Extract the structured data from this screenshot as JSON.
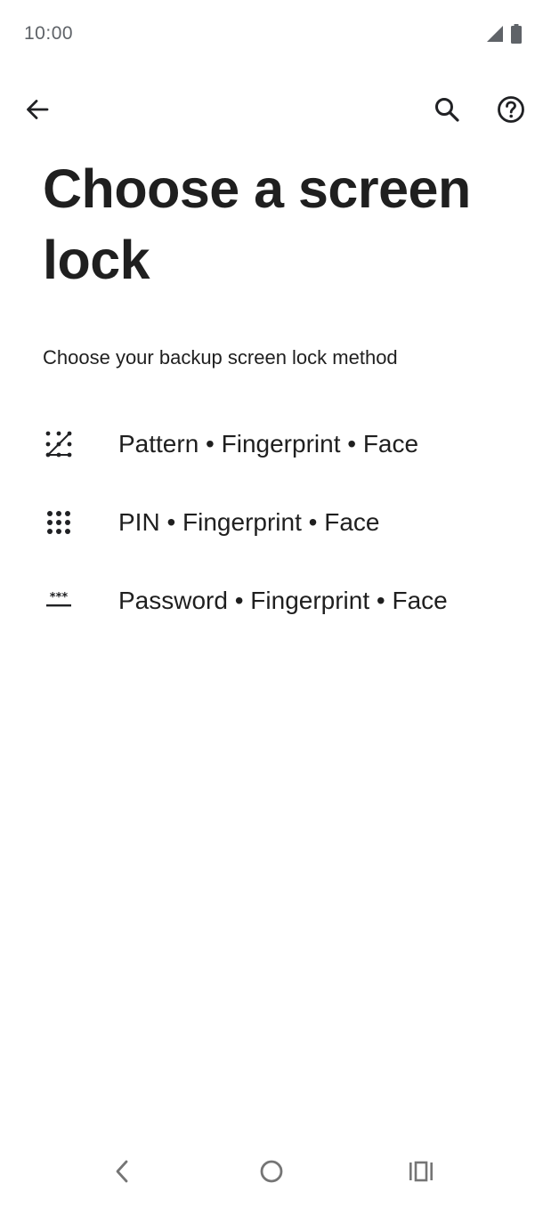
{
  "status_bar": {
    "time": "10:00",
    "icons": [
      "cellular-signal-icon",
      "battery-icon"
    ]
  },
  "app_bar": {
    "back_icon": "arrow-back-icon",
    "search_icon": "search-icon",
    "help_icon": "help-circle-icon"
  },
  "page": {
    "title": "Choose a screen lock",
    "subtitle": "Choose your backup screen lock method"
  },
  "options": [
    {
      "icon": "pattern-icon",
      "label": "Pattern • Fingerprint • Face"
    },
    {
      "icon": "pin-icon",
      "label": "PIN • Fingerprint • Face"
    },
    {
      "icon": "password-icon",
      "label": "Password • Fingerprint • Face"
    }
  ],
  "nav_bar": {
    "back_icon": "nav-back-icon",
    "home_icon": "nav-home-icon",
    "recents_icon": "nav-recents-icon"
  },
  "colors": {
    "text": "#1f1f1f",
    "icon": "#202124",
    "status_text": "#5f6368",
    "nav_icon": "#757575",
    "background": "#ffffff"
  }
}
